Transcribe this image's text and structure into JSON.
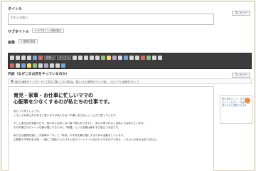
{
  "title_section": {
    "label": "タイトル",
    "preview_button": "プレビュー",
    "value": "わたしの思い"
  },
  "subtitle_section": {
    "label": "サブタイトル",
    "add_button": "サブタイトル欄を表示"
  },
  "image_section": {
    "label": "画像",
    "add_button": "画像を追加"
  },
  "toolbar": {
    "format_select": "段落",
    "size_select": "サイズ"
  },
  "content_section": {
    "label": "内容（なぜこのお店をやっているのか）",
    "preview_button": "プレビュー",
    "info": "最初に画像をアップロードして本文に挿入したい場合は、挿入したい場所をクリック後、このエリアに画像をドロップ",
    "headline_lines": [
      "育児・家事・お仕事に忙しいママの",
      "心配事を少なくするのが私たちの仕事です。"
    ],
    "paragraphs": [
      "安心って何でしょうか。\nいろいろな考え方があると思いますが私たちは「不便にならない」ことだと思っています。",
      "すこし食生活を見直すだけ、他の中には良くない食べ物もありますし、安心が得られるとは私たちは考えています。\nその不便さのダメージを最小限にするために「無理」という言葉は使わずに役立つお店です。",
      "私たちは保険を通じ、お客様の「今」と「未来」の不安を最小限にするための活動をしています。\n心配事や不安がある時、一緒にご相談いただける人生のパートナーとなれたらそれだけで幸せ、これ以上の幸せはありません。"
    ],
    "side_note": "例を参考にして、文字を入力してください。内容が確認されると更新されます。"
  }
}
